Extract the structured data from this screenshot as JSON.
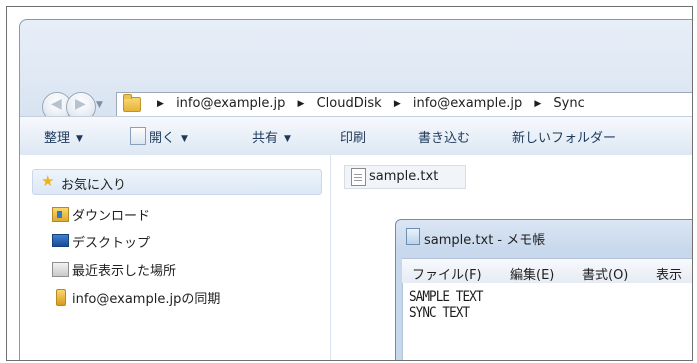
{
  "address": {
    "crumbs": [
      "info@example.jp",
      "CloudDisk",
      "info@example.jp",
      "Sync"
    ]
  },
  "toolbar": {
    "organize": "整理",
    "open": "開く",
    "share": "共有",
    "print": "印刷",
    "burn": "書き込む",
    "new_folder": "新しいフォルダー"
  },
  "navpane": {
    "favorites": "お気に入り",
    "items": [
      "ダウンロード",
      "デスクトップ",
      "最近表示した場所",
      "info@example.jpの同期"
    ]
  },
  "files": [
    {
      "name": "sample.txt"
    }
  ],
  "notepad": {
    "title": "sample.txt - メモ帳",
    "menu": [
      "ファイル(F)",
      "編集(E)",
      "書式(O)",
      "表示"
    ],
    "lines": [
      "SAMPLE TEXT",
      "SYNC TEXT"
    ]
  },
  "colors": {
    "toolbar_text": "#1e395b",
    "window_bg": "#dfe8f4",
    "star": "#f0b21b"
  }
}
